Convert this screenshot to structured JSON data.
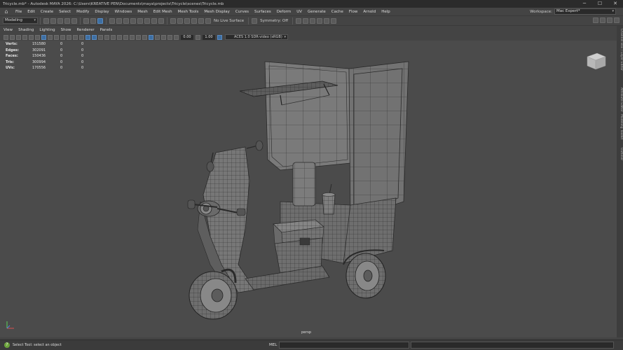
{
  "window": {
    "title": "Tricycle.mb* - Autodesk MAYA 2026: C:\\Users\\KREATIVE PEN\\Documents\\maya\\projects\\Tricycle\\scenes\\Tricycle.mb",
    "minimize": "─",
    "maximize": "☐",
    "close": "✕"
  },
  "menubar": {
    "items": [
      "File",
      "Edit",
      "Create",
      "Select",
      "Modify",
      "Display",
      "Windows",
      "Mesh",
      "Edit Mesh",
      "Mesh Tools",
      "Mesh Display",
      "Curves",
      "Surfaces",
      "Deform",
      "UV",
      "Generate",
      "Cache",
      "Flow",
      "Arnold",
      "Help"
    ],
    "workspace_label": "Workspace:",
    "workspace_value": "Mac Expert*"
  },
  "statusline": {
    "mode": "Modeling",
    "live_surface": "No Live Surface",
    "symmetry": "Symmetry: Off"
  },
  "panelmenu": {
    "items": [
      "View",
      "Shading",
      "Lighting",
      "Show",
      "Renderer",
      "Panels"
    ]
  },
  "viewtoolbar": {
    "exposure": "0.00",
    "gamma": "1.00",
    "colorspace": "ACES 1.0 SDR-video (sRGB)"
  },
  "hud": {
    "rows": [
      {
        "label": "Verts:",
        "total": "151580",
        "sel": "0",
        "sel2": "0"
      },
      {
        "label": "Edges:",
        "total": "302091",
        "sel": "0",
        "sel2": "0"
      },
      {
        "label": "Faces:",
        "total": "150436",
        "sel": "0",
        "sel2": "0"
      },
      {
        "label": "Tris:",
        "total": "300994",
        "sel": "0",
        "sel2": "0"
      },
      {
        "label": "UVs:",
        "total": "170556",
        "sel": "0",
        "sel2": "0"
      }
    ]
  },
  "viewport": {
    "camera": "persp",
    "grid": false,
    "background_color": "#4b4b4b"
  },
  "rightdock": {
    "tabs": [
      "Channel Box / Layer Editor",
      "Attribute Editor",
      "Modeling Toolkit",
      "Outliner"
    ]
  },
  "commandline": {
    "help_text": "Select Tool: select an object",
    "language": "MEL"
  }
}
